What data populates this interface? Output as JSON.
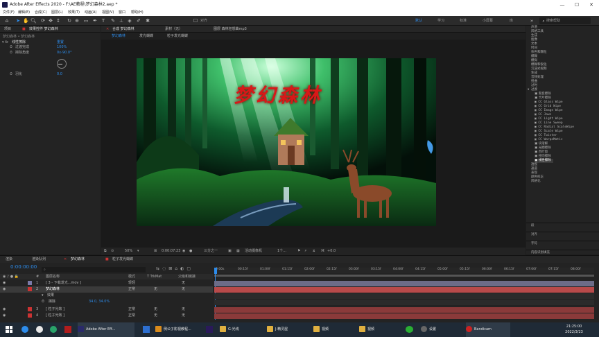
{
  "window": {
    "title": "Adobe After Effects 2020 - F:\\AE教程\\梦幻森林2.aep *",
    "controls": [
      "—",
      "☐",
      "✕"
    ]
  },
  "menu": [
    "文件(F)",
    "编辑(E)",
    "合成(C)",
    "图层(L)",
    "效果(T)",
    "动画(A)",
    "视图(V)",
    "窗口",
    "帮助(H)"
  ],
  "toolbar": {
    "snap_label": "对齐",
    "workspaces": [
      "默认",
      "学习",
      "标准",
      "小屏幕",
      "库"
    ],
    "search_placeholder": "搜索帮助"
  },
  "left_panel": {
    "tabs": [
      "项目",
      "效果控件 梦幻森林"
    ],
    "breadcrumb": "梦幻森林 • 梦幻森林",
    "effect_name": "线性擦除",
    "reset_label": "重置",
    "props": [
      {
        "label": "过渡完成",
        "value": "100%"
      },
      {
        "label": "擦除角度",
        "value": "0x-90.0°"
      },
      {
        "label": "羽化",
        "value": "0.0"
      }
    ]
  },
  "composition": {
    "tabs": [
      "合成 梦幻森林",
      "素材（无）",
      "图层 森林狂想曲mp3"
    ],
    "subtabs": [
      "梦幻森林",
      "发光蝴蝶",
      "粒子发光蝴蝶"
    ],
    "scene_title": "梦幻森林"
  },
  "viewer_bar": {
    "zoom": "50%",
    "timecode": "0:00:07:23",
    "resolution": "三分之一",
    "camera": "活动摄像机",
    "views": "1个...",
    "exposure": "+0.0"
  },
  "right_panel": {
    "items": [
      "声道",
      "风格工具",
      "生成",
      "抠像",
      "文本",
      "时间",
      "杂色和颗粒",
      "模糊",
      "模拟",
      "模糊和锐化",
      "沉浸式视频",
      "生成",
      "音频处理",
      "扭曲",
      "过时",
      "过渡"
    ],
    "transitions": [
      "渐变擦除",
      "卡片擦除",
      "CC Glass Wipe",
      "CC Grid Wipe",
      "CC Image Wipe",
      "CC Jaws",
      "CC Light Wipe",
      "CC Line Sweep",
      "CC Radial ScaleWipe",
      "CC Scale Wipe",
      "CC Twister",
      "CC WarpoMatic",
      "块溶解",
      "光圈擦除",
      "百叶窗",
      "径向擦除",
      "线性擦除"
    ],
    "after": [
      "透视",
      "通道",
      "表现",
      "颜色校正",
      "风格化"
    ],
    "bottom_tabs": [
      "段",
      "对齐",
      "字符",
      "内容识别填充"
    ]
  },
  "timeline": {
    "tabs": [
      "渲染",
      "渲染队列",
      "梦幻森林",
      "粒子发光蝴蝶"
    ],
    "timecode": "0:00:00:00",
    "headers": [
      "#",
      "图层名称",
      "模式",
      "T TrkMat",
      "父级和链接"
    ],
    "layers": [
      {
        "num": "1",
        "name": "[ 3 - 下载发光...mov ]",
        "mode": "轻轻",
        "trk": "",
        "parent": "无"
      },
      {
        "num": "2",
        "name": "梦幻森林",
        "mode": "正常",
        "trk": "无",
        "parent": "无"
      },
      {
        "num": "",
        "name": "效果",
        "mode": "",
        "trk": "",
        "parent": ""
      },
      {
        "num": "",
        "name": "擦除",
        "mode": "",
        "trk": "",
        "parent": ""
      },
      {
        "num": "3",
        "name": "[ 粒子光效 ]",
        "mode": "正常",
        "trk": "无",
        "parent": "无"
      },
      {
        "num": "4",
        "name": "[ 粒子光效 ]",
        "mode": "正常",
        "trk": "无",
        "parent": "无"
      }
    ],
    "sub_value": "34.0, 34.0%",
    "ruler": [
      "0:00s",
      "00:15f",
      "01:00f",
      "01:15f",
      "02:00f",
      "02:15f",
      "03:00f",
      "03:15f",
      "04:00f",
      "04:15f",
      "05:00f",
      "05:15f",
      "06:00f",
      "06:15f",
      "07:00f",
      "07:15f",
      "08:00f"
    ]
  },
  "taskbar": {
    "items": [
      {
        "label": "Adobe After Eff...",
        "color": "#2a2a6a"
      },
      {
        "label": "例公子影视教程...",
        "color": "#d98b1c"
      },
      {
        "label": "G-光线",
        "color": "#e0b040"
      },
      {
        "label": "J-精灵屋",
        "color": "#e0b040"
      },
      {
        "label": "视频",
        "color": "#e0b040"
      },
      {
        "label": "视频",
        "color": "#e0b040"
      },
      {
        "label": "设置",
        "color": "#666"
      },
      {
        "label": "Bandicam",
        "color": "#c22"
      }
    ],
    "clock_time": "21:25:00",
    "clock_date": "2022/3/23"
  }
}
